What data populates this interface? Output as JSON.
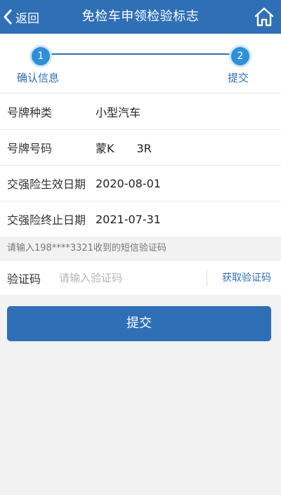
{
  "header": {
    "back_label": "返回",
    "title": "免检车申领检验标志",
    "home_icon": "home-icon"
  },
  "steps": [
    {
      "number": "1",
      "label": "确认信息"
    },
    {
      "number": "2",
      "label": "提交"
    }
  ],
  "info": {
    "rows": [
      {
        "label": "号牌种类",
        "value": "小型汽车"
      },
      {
        "label": "号牌号码",
        "value": "蒙K　　3R"
      },
      {
        "label": "交强险生效日期",
        "value": "2020-08-01"
      },
      {
        "label": "交强险终止日期",
        "value": "2021-07-31"
      }
    ]
  },
  "hint": "请输入198****3321收到的短信验证码",
  "code": {
    "label": "验证码",
    "placeholder": "请输入验证码",
    "value": "",
    "get_code_label": "获取验证码"
  },
  "submit_label": "提交",
  "colors": {
    "primary": "#2f6fb5",
    "step_circle": "#2f8fd8",
    "background": "#f2f2f2"
  }
}
